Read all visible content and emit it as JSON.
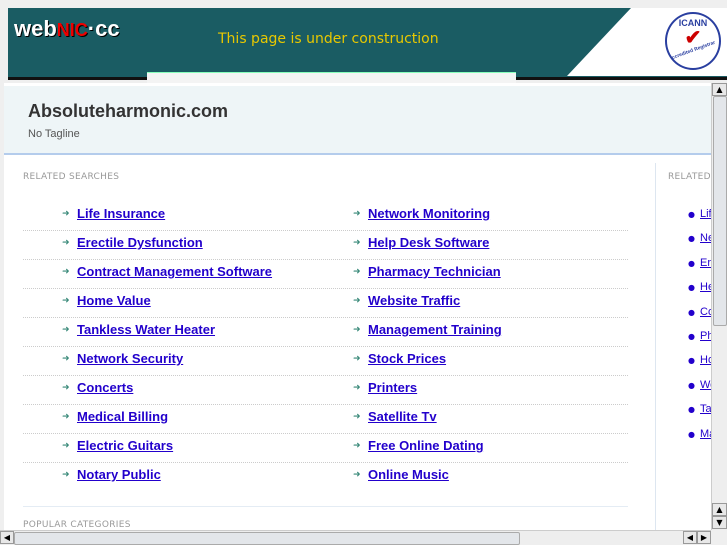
{
  "banner": {
    "logo_web": "web",
    "logo_nic": "NIC",
    "logo_cc": "·cc",
    "message": "This page is under construction",
    "icann_text": "ICANN",
    "icann_sub": "Accredited Registrar"
  },
  "site": {
    "title": "Absoluteharmonic.com",
    "tagline": "No Tagline"
  },
  "related_searches": {
    "heading": "RELATED SEARCHES",
    "left": [
      "Life Insurance",
      "Erectile Dysfunction",
      "Contract Management Software",
      "Home Value",
      "Tankless Water Heater",
      "Network Security",
      "Concerts",
      "Medical Billing",
      "Electric Guitars",
      "Notary Public"
    ],
    "right": [
      "Network Monitoring",
      "Help Desk Software",
      "Pharmacy Technician",
      "Website Traffic",
      "Management Training",
      "Stock Prices",
      "Printers",
      "Satellite Tv",
      "Free Online Dating",
      "Online Music"
    ]
  },
  "popular_categories": {
    "heading": "POPULAR CATEGORIES"
  },
  "sidebar": {
    "heading": "RELATED",
    "items": [
      "Life",
      "Ne",
      "Ere",
      "He",
      "Co",
      "Pha",
      "Ho",
      "We",
      "Ta",
      "Ma"
    ]
  },
  "icons": {
    "arrow": "arrow-right-icon",
    "bullet": "bullet-icon"
  }
}
